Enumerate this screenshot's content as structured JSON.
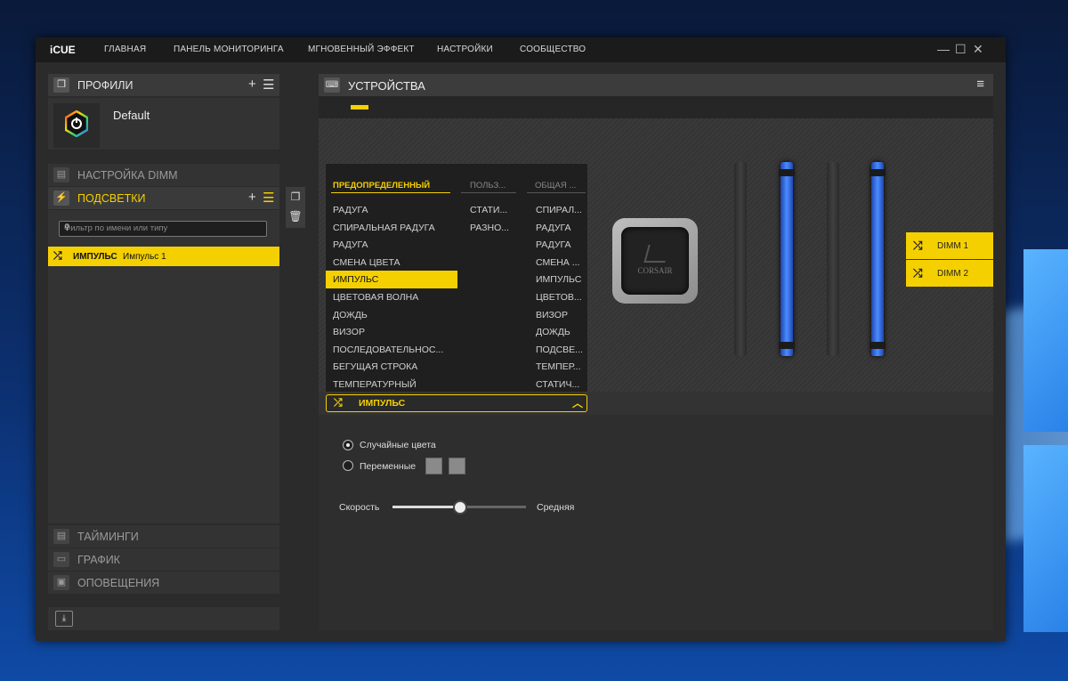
{
  "titlebar": {
    "logo": "iCUE",
    "nav": [
      "ГЛАВНАЯ",
      "ПАНЕЛЬ МОНИТОРИНГА",
      "МГНОВЕННЫЙ ЭФФЕКТ",
      "НАСТРОЙКИ",
      "СООБЩЕСТВО"
    ],
    "controls": {
      "minimize": "—",
      "maximize": "☐",
      "close": "✕"
    }
  },
  "profiles": {
    "header": "ПРОФИЛИ",
    "add_label": "+",
    "menu_label": "☰",
    "items": [
      {
        "name": "Default"
      }
    ]
  },
  "sections": {
    "dimm_setup": "НАСТРОЙКА DIMM",
    "lighting": "ПОДСВЕТКИ",
    "timings": "ТАЙМИНГИ",
    "graph": "ГРАФИК",
    "notifications": "ОПОВЕЩЕНИЯ"
  },
  "filter": {
    "placeholder": "Фильтр по имени или типу"
  },
  "lighting_items": [
    {
      "name": "ИМПУЛЬС",
      "subname": "Импульс 1"
    }
  ],
  "devices": {
    "header": "УСТРОЙСТВА",
    "cooler_brand": "CORSAIR"
  },
  "dimm_tags": [
    "DIMM 1",
    "DIMM 2"
  ],
  "dropdown": {
    "columns": [
      "ПРЕДОПРЕДЕЛЕННЫЙ",
      "ПОЛЬЗ...",
      "ОБЩАЯ ..."
    ],
    "predefined": [
      "РАДУГА",
      "СПИРАЛЬНАЯ РАДУГА",
      "РАДУГА",
      "СМЕНА ЦВЕТА",
      "ИМПУЛЬС",
      "ЦВЕТОВАЯ ВОЛНА",
      "ДОЖДЬ",
      "ВИЗОР",
      "ПОСЛЕДОВАТЕЛЬНОС...",
      "БЕГУЩАЯ СТРОКА",
      "ТЕМПЕРАТУРНЫЙ"
    ],
    "custom": [
      "СТАТИ...",
      "РАЗНО..."
    ],
    "shared": [
      "СПИРАЛ...",
      "РАДУГА",
      "РАДУГА",
      "СМЕНА ...",
      "ИМПУЛЬС",
      "ЦВЕТОВ...",
      "ВИЗОР",
      "ДОЖДЬ",
      "ПОДСВЕ...",
      "ТЕМПЕР...",
      "СТАТИЧ..."
    ],
    "selected": "ИМПУЛЬС",
    "current_effect": "ИМПУЛЬС"
  },
  "settings": {
    "random_colors": "Случайные цвета",
    "alternating": "Переменные",
    "speed_label": "Скорость",
    "speed_value": "Средняя",
    "speed_level": 0.5,
    "color_mode": "random"
  },
  "colors": {
    "accent": "#f5d000",
    "dimm_led": "#4a8cff"
  }
}
